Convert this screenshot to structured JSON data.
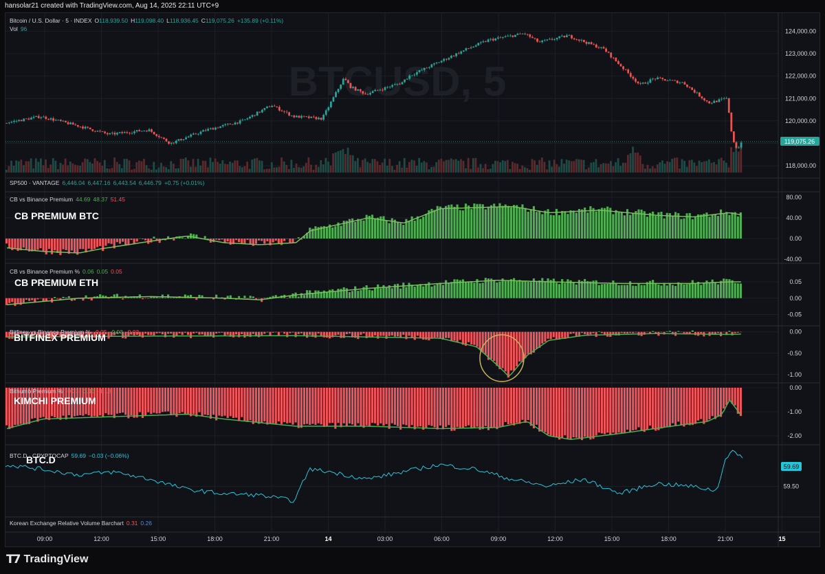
{
  "header": {
    "credit": "hansolar21 created with TradingView.com, Aug 14, 2025 22:11 UTC+9"
  },
  "footer": {
    "logo_text": "TradingView",
    "logo_icon": "tradingview-logo-icon"
  },
  "colors": {
    "bg": "#111218",
    "up": "#26a69a",
    "down": "#ef5350",
    "green": "#4caf50",
    "red": "#f0545b",
    "teal": "#26c6da",
    "grid": "#1d1f26",
    "axis": "#9598a1",
    "circle": "#c8b25a"
  },
  "main_pane": {
    "symbol": "Bitcoin / U.S. Dollar · 5 · INDEX",
    "o_label": "O",
    "o": "118,939.50",
    "h_label": "H",
    "h": "119,098.40",
    "l_label": "L",
    "l": "118,936.45",
    "c_label": "C",
    "c": "119,075.26",
    "change": "+135.89 (+0.11%)",
    "vol_label": "Vol",
    "vol": "96",
    "watermark": "BTCUSD, 5",
    "last_price": "119,075.26"
  },
  "sp500": {
    "label": "SP500 · VANTAGE",
    "o": "6,446.04",
    "h": "6,447.16",
    "l": "6,443.54",
    "c": "6,446.79",
    "change": "+0.75 (+0.01%)"
  },
  "panes": [
    {
      "title": "CB vs Binance Premium",
      "values": [
        "44.69",
        "48.37",
        "51.45"
      ],
      "overlay": "CB PREMIUM BTC"
    },
    {
      "title": "CB vs Binance Premium %",
      "values": [
        "0.06",
        "0.05",
        "0.05"
      ],
      "overlay": "CB PREMIUM ETH"
    },
    {
      "title": "Bitfinex vs Binance Premium %",
      "values": [
        "-0.05",
        "-0.03",
        "-0.03"
      ],
      "overlay": "BITFINEX PREMIUM"
    },
    {
      "title": "Bithumb Premium %",
      "values": [
        "-0.33",
        "-1.13",
        "-1.13"
      ],
      "overlay": "KIMCHI PREMIUM"
    },
    {
      "title": "BTC.D · CRYPTOCAP",
      "values": [
        "59.69",
        "−0.03 (−0.06%)"
      ],
      "overlay": "BTC.D",
      "last": "59.69"
    },
    {
      "title": "Korean Exchange Relative Volume Barchart",
      "values": [
        "0.31",
        "0.26"
      ]
    }
  ],
  "time_axis": [
    "09:00",
    "12:00",
    "15:00",
    "18:00",
    "21:00",
    "14",
    "03:00",
    "06:00",
    "09:00",
    "12:00",
    "15:00",
    "18:00",
    "21:00",
    "15"
  ],
  "chart_data": [
    {
      "type": "candlestick",
      "title": "Bitcoin / U.S. Dollar · 5 · INDEX",
      "x_start": "Aug 13 07:00",
      "x_end": "Aug 14 22:10",
      "ylim": [
        117700,
        124500
      ],
      "yticks": [
        "118,000.00",
        "119,000.00",
        "120,000.00",
        "121,000.00",
        "122,000.00",
        "123,000.00",
        "124,000.00"
      ],
      "anchors": [
        [
          0,
          119900
        ],
        [
          0.05,
          120200
        ],
        [
          0.1,
          119800
        ],
        [
          0.145,
          119400
        ],
        [
          0.2,
          119600
        ],
        [
          0.23,
          119000
        ],
        [
          0.28,
          119600
        ],
        [
          0.33,
          120000
        ],
        [
          0.37,
          120700
        ],
        [
          0.4,
          120200
        ],
        [
          0.44,
          120100
        ],
        [
          0.47,
          121900
        ],
        [
          0.48,
          121500
        ],
        [
          0.5,
          121200
        ],
        [
          0.55,
          121700
        ],
        [
          0.56,
          122000
        ],
        [
          0.6,
          122600
        ],
        [
          0.64,
          123200
        ],
        [
          0.67,
          123600
        ],
        [
          0.72,
          123900
        ],
        [
          0.74,
          123500
        ],
        [
          0.78,
          123800
        ],
        [
          0.83,
          123200
        ],
        [
          0.88,
          121600
        ],
        [
          0.9,
          121900
        ],
        [
          0.94,
          121700
        ],
        [
          0.975,
          120800
        ],
        [
          1.0,
          121000
        ],
        [
          1.008,
          119200
        ],
        [
          1.015,
          118700
        ],
        [
          1.02,
          119075
        ]
      ],
      "last": 119075.26
    },
    {
      "type": "bar",
      "title": "CB vs Binance Premium",
      "ylim": [
        -40,
        80
      ],
      "yticks": [
        "80.00",
        "40.00",
        "0.00",
        "-40.00"
      ],
      "anchors": [
        [
          0,
          -18
        ],
        [
          0.05,
          -25
        ],
        [
          0.1,
          -28
        ],
        [
          0.13,
          -20
        ],
        [
          0.2,
          -5
        ],
        [
          0.25,
          5
        ],
        [
          0.3,
          -8
        ],
        [
          0.35,
          -12
        ],
        [
          0.4,
          -8
        ],
        [
          0.42,
          15
        ],
        [
          0.5,
          40
        ],
        [
          0.55,
          30
        ],
        [
          0.6,
          58
        ],
        [
          0.7,
          62
        ],
        [
          0.75,
          50
        ],
        [
          0.82,
          55
        ],
        [
          0.9,
          45
        ],
        [
          0.95,
          42
        ],
        [
          1.0,
          50
        ],
        [
          1.02,
          45
        ]
      ]
    },
    {
      "type": "bar",
      "title": "CB vs Binance Premium %",
      "ylim": [
        -0.07,
        0.09
      ],
      "yticks": [
        "0.05",
        "0.00",
        "-0.05"
      ],
      "anchors": [
        [
          0,
          -0.02
        ],
        [
          0.05,
          -0.01
        ],
        [
          0.1,
          0.0
        ],
        [
          0.2,
          0.005
        ],
        [
          0.3,
          0.0
        ],
        [
          0.35,
          -0.005
        ],
        [
          0.4,
          0.01
        ],
        [
          0.45,
          0.02
        ],
        [
          0.5,
          0.03
        ],
        [
          0.6,
          0.045
        ],
        [
          0.68,
          0.055
        ],
        [
          0.75,
          0.05
        ],
        [
          0.85,
          0.045
        ],
        [
          0.95,
          0.045
        ],
        [
          1.0,
          0.05
        ],
        [
          1.02,
          0.05
        ]
      ]
    },
    {
      "type": "bar",
      "title": "Bitfinex vs Binance Premium %",
      "ylim": [
        -1.1,
        0.06
      ],
      "yticks": [
        "0.00",
        "-0.50",
        "-1.00"
      ],
      "anchors": [
        [
          0,
          -0.12
        ],
        [
          0.2,
          -0.1
        ],
        [
          0.4,
          -0.09
        ],
        [
          0.5,
          -0.12
        ],
        [
          0.6,
          -0.15
        ],
        [
          0.65,
          -0.35
        ],
        [
          0.68,
          -0.8
        ],
        [
          0.695,
          -1.05
        ],
        [
          0.72,
          -0.55
        ],
        [
          0.75,
          -0.2
        ],
        [
          0.8,
          -0.08
        ],
        [
          0.9,
          -0.04
        ],
        [
          1.0,
          -0.06
        ],
        [
          1.02,
          -0.05
        ]
      ]
    },
    {
      "type": "bar",
      "title": "Bithumb Premium %",
      "ylim": [
        -2.2,
        0.0
      ],
      "yticks": [
        "0.00",
        "-1.00",
        "-2.00"
      ],
      "anchors": [
        [
          0,
          -1.7
        ],
        [
          0.05,
          -1.3
        ],
        [
          0.15,
          -1.2
        ],
        [
          0.25,
          -1.1
        ],
        [
          0.3,
          -1.3
        ],
        [
          0.4,
          -1.6
        ],
        [
          0.5,
          -1.6
        ],
        [
          0.6,
          -1.7
        ],
        [
          0.68,
          -1.65
        ],
        [
          0.72,
          -1.4
        ],
        [
          0.75,
          -2.0
        ],
        [
          0.78,
          -2.15
        ],
        [
          0.85,
          -1.9
        ],
        [
          0.92,
          -1.6
        ],
        [
          0.97,
          -1.4
        ],
        [
          0.99,
          -1.1
        ],
        [
          1.0,
          -0.5
        ],
        [
          1.02,
          -1.3
        ]
      ]
    },
    {
      "type": "line",
      "title": "BTC.D · CRYPTOCAP",
      "ylim": [
        59.35,
        59.75
      ],
      "yticks": [
        "59.50"
      ],
      "anchors": [
        [
          0,
          59.65
        ],
        [
          0.05,
          59.62
        ],
        [
          0.1,
          59.58
        ],
        [
          0.15,
          59.6
        ],
        [
          0.2,
          59.55
        ],
        [
          0.25,
          59.48
        ],
        [
          0.3,
          59.45
        ],
        [
          0.35,
          59.44
        ],
        [
          0.4,
          59.4
        ],
        [
          0.42,
          59.62
        ],
        [
          0.45,
          59.6
        ],
        [
          0.5,
          59.55
        ],
        [
          0.55,
          59.6
        ],
        [
          0.6,
          59.65
        ],
        [
          0.65,
          59.62
        ],
        [
          0.7,
          59.55
        ],
        [
          0.75,
          59.5
        ],
        [
          0.8,
          59.55
        ],
        [
          0.85,
          59.45
        ],
        [
          0.9,
          59.52
        ],
        [
          0.95,
          59.5
        ],
        [
          0.985,
          59.47
        ],
        [
          0.995,
          59.68
        ],
        [
          1.005,
          59.75
        ],
        [
          1.02,
          59.69
        ]
      ],
      "last": 59.69
    }
  ]
}
